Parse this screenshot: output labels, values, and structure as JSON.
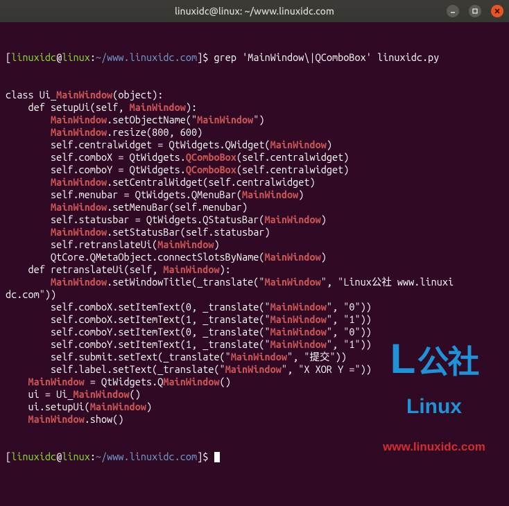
{
  "titlebar": {
    "title": "linuxidc@linux: ~/www.linuxidc.com"
  },
  "prompt": {
    "user": "linuxidc",
    "at": "@",
    "host": "linux",
    "sep": ":",
    "path": "~/www.linuxidc.com",
    "dollar": "]$ "
  },
  "command": "grep 'MainWindow\\|QComboBox' linuxidc.py",
  "lines": [
    {
      "segs": [
        {
          "t": "class Ui_"
        },
        {
          "t": "MainWindow",
          "h": true
        },
        {
          "t": "(object):"
        }
      ]
    },
    {
      "segs": [
        {
          "t": "    def setupUi(self, "
        },
        {
          "t": "MainWindow",
          "h": true
        },
        {
          "t": "):"
        }
      ]
    },
    {
      "segs": [
        {
          "t": "        "
        },
        {
          "t": "MainWindow",
          "h": true
        },
        {
          "t": ".setObjectName(\""
        },
        {
          "t": "MainWindow",
          "h": true
        },
        {
          "t": "\")"
        }
      ]
    },
    {
      "segs": [
        {
          "t": "        "
        },
        {
          "t": "MainWindow",
          "h": true
        },
        {
          "t": ".resize(800, 600)"
        }
      ]
    },
    {
      "segs": [
        {
          "t": "        self.centralwidget = QtWidgets.QWidget("
        },
        {
          "t": "MainWindow",
          "h": true
        },
        {
          "t": ")"
        }
      ]
    },
    {
      "segs": [
        {
          "t": "        self.comboX = QtWidgets."
        },
        {
          "t": "QComboBox",
          "h": true
        },
        {
          "t": "(self.centralwidget)"
        }
      ]
    },
    {
      "segs": [
        {
          "t": "        self.comboY = QtWidgets."
        },
        {
          "t": "QComboBox",
          "h": true
        },
        {
          "t": "(self.centralwidget)"
        }
      ]
    },
    {
      "segs": [
        {
          "t": "        "
        },
        {
          "t": "MainWindow",
          "h": true
        },
        {
          "t": ".setCentralWidget(self.centralwidget)"
        }
      ]
    },
    {
      "segs": [
        {
          "t": "        self.menubar = QtWidgets.QMenuBar("
        },
        {
          "t": "MainWindow",
          "h": true
        },
        {
          "t": ")"
        }
      ]
    },
    {
      "segs": [
        {
          "t": "        "
        },
        {
          "t": "MainWindow",
          "h": true
        },
        {
          "t": ".setMenuBar(self.menubar)"
        }
      ]
    },
    {
      "segs": [
        {
          "t": "        self.statusbar = QtWidgets.QStatusBar("
        },
        {
          "t": "MainWindow",
          "h": true
        },
        {
          "t": ")"
        }
      ]
    },
    {
      "segs": [
        {
          "t": "        "
        },
        {
          "t": "MainWindow",
          "h": true
        },
        {
          "t": ".setStatusBar(self.statusbar)"
        }
      ]
    },
    {
      "segs": [
        {
          "t": "        self.retranslateUi("
        },
        {
          "t": "MainWindow",
          "h": true
        },
        {
          "t": ")"
        }
      ]
    },
    {
      "segs": [
        {
          "t": "        QtCore.QMetaObject.connectSlotsByName("
        },
        {
          "t": "MainWindow",
          "h": true
        },
        {
          "t": ")"
        }
      ]
    },
    {
      "segs": [
        {
          "t": "    def retranslateUi(self, "
        },
        {
          "t": "MainWindow",
          "h": true
        },
        {
          "t": "):"
        }
      ]
    },
    {
      "segs": [
        {
          "t": "        "
        },
        {
          "t": "MainWindow",
          "h": true
        },
        {
          "t": ".setWindowTitle(_translate(\""
        },
        {
          "t": "MainWindow",
          "h": true
        },
        {
          "t": "\", \"Linux公社 www.linuxi"
        }
      ]
    },
    {
      "segs": [
        {
          "t": "dc.com\"))"
        }
      ]
    },
    {
      "segs": [
        {
          "t": "        self.comboX.setItemText(0, _translate(\""
        },
        {
          "t": "MainWindow",
          "h": true
        },
        {
          "t": "\", \"0\"))"
        }
      ]
    },
    {
      "segs": [
        {
          "t": "        self.comboX.setItemText(1, _translate(\""
        },
        {
          "t": "MainWindow",
          "h": true
        },
        {
          "t": "\", \"1\"))"
        }
      ]
    },
    {
      "segs": [
        {
          "t": "        self.comboY.setItemText(0, _translate(\""
        },
        {
          "t": "MainWindow",
          "h": true
        },
        {
          "t": "\", \"0\"))"
        }
      ]
    },
    {
      "segs": [
        {
          "t": "        self.comboY.setItemText(1, _translate(\""
        },
        {
          "t": "MainWindow",
          "h": true
        },
        {
          "t": "\", \"1\"))"
        }
      ]
    },
    {
      "segs": [
        {
          "t": "        self.submit.setText(_translate(\""
        },
        {
          "t": "MainWindow",
          "h": true
        },
        {
          "t": "\", \"提交\"))"
        }
      ]
    },
    {
      "segs": [
        {
          "t": "        self.label.setText(_translate(\""
        },
        {
          "t": "MainWindow",
          "h": true
        },
        {
          "t": "\", \"X XOR Y =\"))"
        }
      ]
    },
    {
      "segs": [
        {
          "t": "    "
        },
        {
          "t": "MainWindow",
          "h": true
        },
        {
          "t": " = QtWidgets.Q"
        },
        {
          "t": "MainWindow",
          "h": true
        },
        {
          "t": "()"
        }
      ]
    },
    {
      "segs": [
        {
          "t": "    ui = Ui_"
        },
        {
          "t": "MainWindow",
          "h": true
        },
        {
          "t": "()"
        }
      ]
    },
    {
      "segs": [
        {
          "t": "    ui.setupUi("
        },
        {
          "t": "MainWindow",
          "h": true
        },
        {
          "t": ")"
        }
      ]
    },
    {
      "segs": [
        {
          "t": "    "
        },
        {
          "t": "MainWindow",
          "h": true
        },
        {
          "t": ".show()"
        }
      ]
    }
  ],
  "watermark": {
    "big_l": "L",
    "big_gs": "公社",
    "linux": "Linux",
    "url": "www.linuxidc.com"
  }
}
